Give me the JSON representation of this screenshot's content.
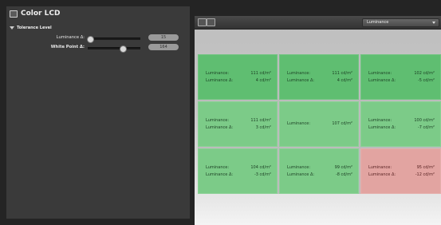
{
  "window": {
    "title": "Color LCD"
  },
  "left_panel": {
    "section_label": "Tolerance Level",
    "controls": [
      {
        "label": "Luminance Δ:",
        "value": "15",
        "level": 0.05
      },
      {
        "label": "White Point Δ:",
        "value": "164",
        "level": 0.67
      }
    ]
  },
  "right_panel": {
    "toolbar": {
      "mode_select_value": "Luminance"
    },
    "grid": [
      {
        "line1_label": "Luminance:",
        "line1_value": "111 cd/m²",
        "line2_label": "Luminance Δ:",
        "line2_value": "4 cd/m²",
        "status": "green"
      },
      {
        "line1_label": "Luminance:",
        "line1_value": "111 cd/m²",
        "line2_label": "Luminance Δ:",
        "line2_value": "4 cd/m²",
        "status": "green"
      },
      {
        "line1_label": "Luminance:",
        "line1_value": "102 cd/m²",
        "line2_label": "Luminance Δ:",
        "line2_value": "-5 cd/m²",
        "status": "green"
      },
      {
        "line1_label": "Luminance:",
        "line1_value": "111 cd/m²",
        "line2_label": "Luminance Δ:",
        "line2_value": "3 cd/m²",
        "status": "light"
      },
      {
        "line1_label": "Luminance:",
        "line1_value": "107 cd/m²",
        "status": "light"
      },
      {
        "line1_label": "Luminance:",
        "line1_value": "100 cd/m²",
        "line2_label": "Luminance Δ:",
        "line2_value": "-7 cd/m²",
        "status": "light"
      },
      {
        "line1_label": "Luminance:",
        "line1_value": "104 cd/m²",
        "line2_label": "Luminance Δ:",
        "line2_value": "-3 cd/m²",
        "status": "light"
      },
      {
        "line1_label": "Luminance:",
        "line1_value": "99 cd/m²",
        "line2_label": "Luminance Δ:",
        "line2_value": "-8 cd/m²",
        "status": "light"
      },
      {
        "line1_label": "Luminance:",
        "line1_value": "95 cd/m²",
        "line2_label": "Luminance Δ:",
        "line2_value": "-12 cd/m²",
        "status": "red"
      }
    ]
  },
  "colors": {
    "pass_green": "#5fbe71",
    "pass_light_green": "#7ccb88",
    "fail_red": "#e2a4a1"
  }
}
